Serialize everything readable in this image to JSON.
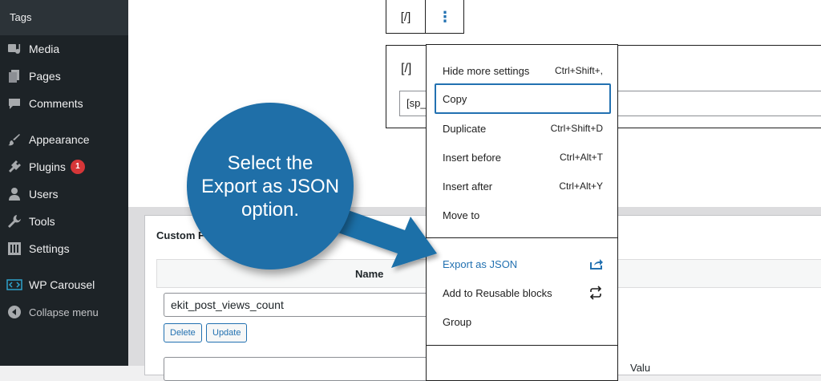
{
  "sidebar": {
    "submenu_item": "Tags",
    "items": [
      {
        "label": "Media",
        "icon": "media-icon"
      },
      {
        "label": "Pages",
        "icon": "pages-icon"
      },
      {
        "label": "Comments",
        "icon": "comments-icon"
      },
      {
        "label": "Appearance",
        "icon": "appearance-icon"
      },
      {
        "label": "Plugins",
        "icon": "plugins-icon",
        "badge": "1"
      },
      {
        "label": "Users",
        "icon": "users-icon"
      },
      {
        "label": "Tools",
        "icon": "tools-icon"
      },
      {
        "label": "Settings",
        "icon": "settings-icon"
      },
      {
        "label": "WP Carousel",
        "icon": "carousel-icon"
      },
      {
        "label": "Collapse menu",
        "icon": "collapse-icon"
      }
    ]
  },
  "editor": {
    "block_toolbar": {
      "shortcode_icon": "[/]",
      "options_icon": "⋮"
    },
    "block": {
      "shortcode_icon": "[/]",
      "input_fragment": "[sp_"
    }
  },
  "custom_fields": {
    "title": "Custom F",
    "name_header": "Name",
    "field_value": "ekit_post_views_count",
    "delete_label": "Delete",
    "update_label": "Update",
    "value_header": "Valu"
  },
  "menu": {
    "items": [
      {
        "label": "Hide more settings",
        "shortcut": "Ctrl+Shift+,"
      },
      {
        "label": "Copy",
        "shortcut": ""
      },
      {
        "label": "Duplicate",
        "shortcut": "Ctrl+Shift+D"
      },
      {
        "label": "Insert before",
        "shortcut": "Ctrl+Alt+T"
      },
      {
        "label": "Insert after",
        "shortcut": "Ctrl+Alt+Y"
      },
      {
        "label": "Move to",
        "shortcut": ""
      },
      {
        "label": "Export as JSON",
        "icon": "export-icon"
      },
      {
        "label": "Add to Reusable blocks",
        "icon": "reusable-icon"
      },
      {
        "label": "Group",
        "shortcut": ""
      }
    ]
  },
  "callout": {
    "text": "Select the Export as JSON option."
  },
  "colors": {
    "accent": "#2271b1",
    "callout": "#1f6fa8",
    "sidebar": "#1d2327",
    "badge": "#d63638"
  }
}
